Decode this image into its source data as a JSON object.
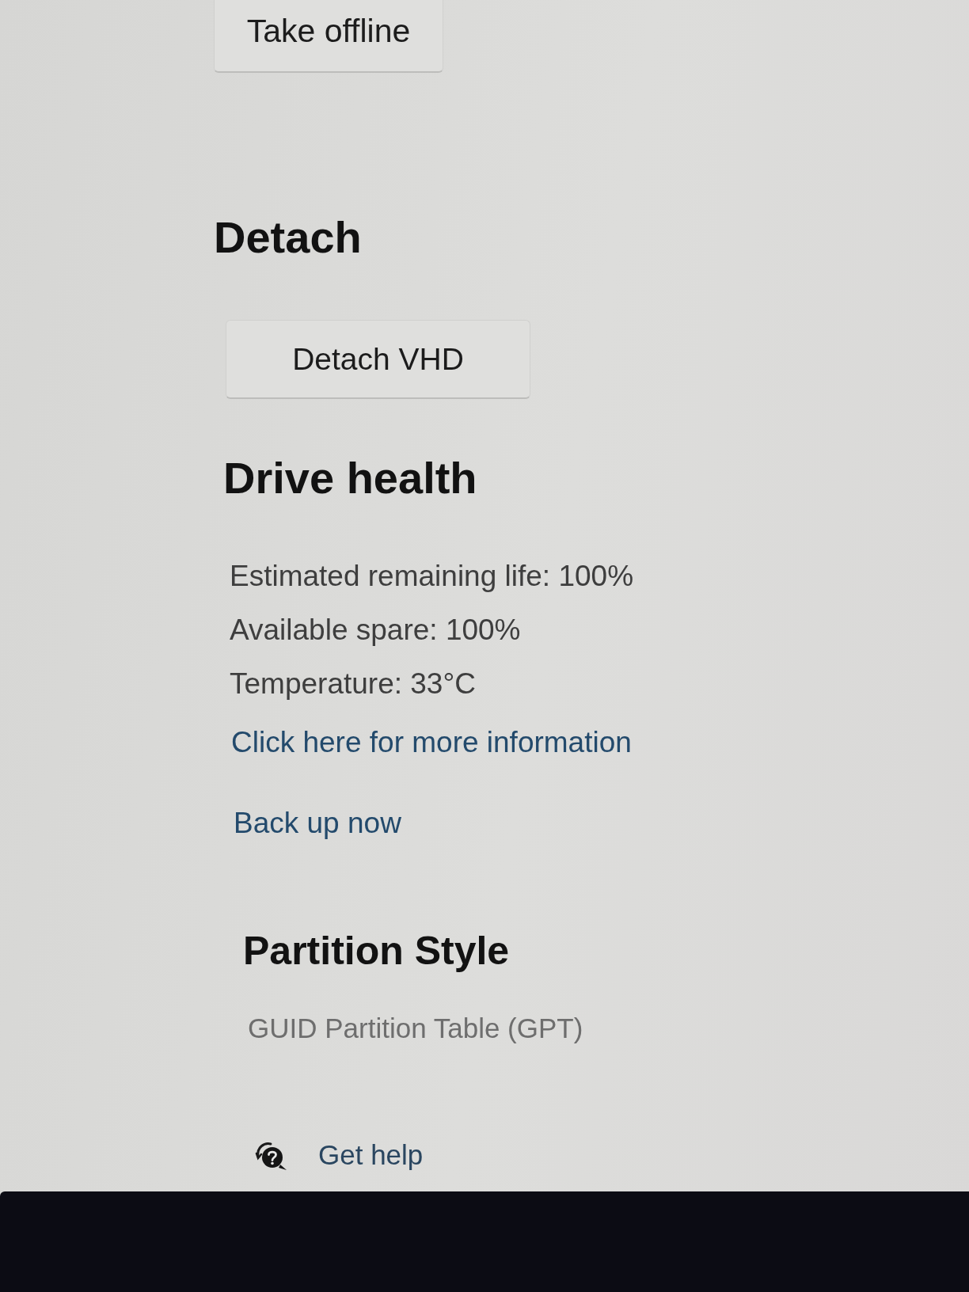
{
  "take_offline_button": {
    "label": "Take offline"
  },
  "detach": {
    "heading": "Detach",
    "button": {
      "label": "Detach VHD"
    }
  },
  "drive_health": {
    "heading": "Drive health",
    "lines": [
      "Estimated remaining life: 100%",
      "Available spare: 100%",
      "Temperature: 33°C"
    ],
    "more_info_link": "Click here for more information",
    "backup_link": "Back up now"
  },
  "partition_style": {
    "heading": "Partition Style",
    "value": "GUID Partition Table (GPT)"
  },
  "get_help": {
    "label": "Get help"
  }
}
